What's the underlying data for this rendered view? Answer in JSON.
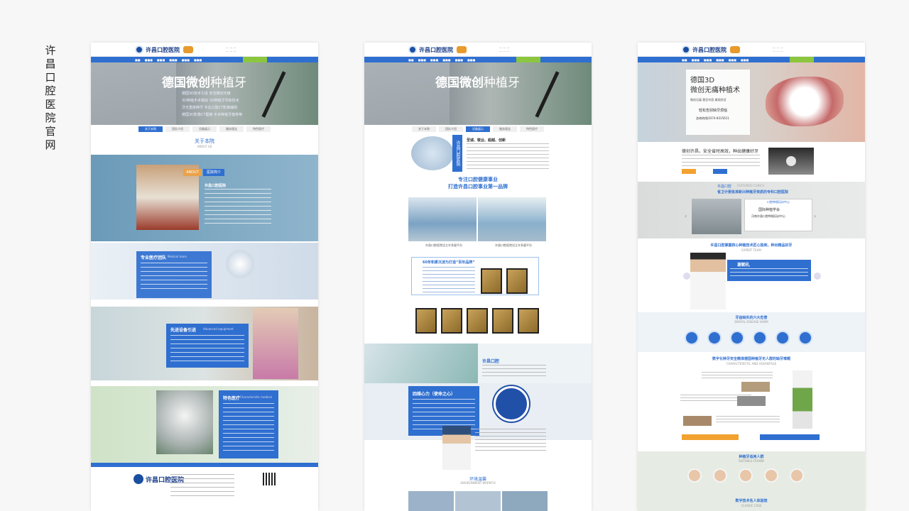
{
  "side_title": [
    "许",
    "昌",
    "口",
    "腔",
    "医",
    "院",
    "官",
    "网"
  ],
  "panel1": {
    "logo_text": "许昌口腔医院",
    "hero_title_bold": "德国微创",
    "hero_title_light": "种植牙",
    "hero_lines": [
      "德国3D技术引进 安全微创无痛",
      "3D种植手术模拟 3D种植牙导板技术",
      "牙无重度种牙 专业口腔CT影像辅助",
      "德国3D影像CT图像 手术种植牙植骨等"
    ],
    "tabs": [
      "关于本院",
      "团队介绍",
      "设备展示",
      "服务理念",
      "特色医疗"
    ],
    "about_title": "关于本院",
    "about_sub": "ABOUT US",
    "about_tag": "ABOUT",
    "about_badge": "医院简介",
    "about_heading": "许昌口腔医院",
    "team_heading": "专业医疗团队",
    "team_sub": "Medical team",
    "equip_heading": "先进设备引进",
    "equip_sub": "Advanced equipment",
    "feature_heading": "特色医疗",
    "feature_sub": "Characteristic medical",
    "footer_logo": "许昌口腔医院"
  },
  "panel2": {
    "logo_text": "许昌口腔医院",
    "hero_title_bold": "德国微创",
    "hero_title_light": "种植牙",
    "tabs": [
      "关于本院",
      "团队介绍",
      "设备展示",
      "服务理念",
      "特色医疗"
    ],
    "intro_vertical": "许昌口腔医院",
    "intro_heading": "至诚、敬业、超越、创新",
    "slogan1": "专注口腔健康事业",
    "slogan2": "打造许昌口腔事业第一品牌",
    "photo_cap1": "许昌口腔医院设立许多量平台",
    "photo_cap2": "许昌口腔医院设立许多量平台",
    "brand_title": "60年积累沉淀为打造“百年品牌”",
    "clinic_heading": "许昌口腔",
    "mission_heading": "四维心力（使命之心）",
    "env_title": "环境温馨",
    "env_sub": "ENVIRONMENT WARMTH"
  },
  "panel3": {
    "logo_text": "许昌口腔医院",
    "hero_title1": "德国3D",
    "hero_title2": "微创无痛种植术",
    "hero_tags": "微创无痛  稳定牢固  美观舒适",
    "hero_cta": "轻松告别缺牙烦恼",
    "hero_phone": "咨询热线|0374-8315611",
    "choose_title": "德创许昌，安全省时高效，种出健康好牙",
    "clinic_tag": "许昌口腔",
    "clinic_tag_en": "FEATURED CLINICS",
    "clinic_title": "省卫计委批准新兴种植牙资质的专科口腔医院",
    "center_label": "口腔种植培训中心",
    "center_plaque1": "国际种植学会",
    "center_plaque2": "河南许昌口腔种植培训中心",
    "expert_title": "许昌口腔掌握核心种植技术匠心独到，种出精品好牙",
    "expert_sub": "EXPERT TEAM",
    "expert_name": "谢朝礼",
    "harm_title": "牙齿缺失的六大危害",
    "harm_sub": "DENTAL DISEASE HARM",
    "adv_title": "数字化种牙安全精准德国种植牙无人群的缺牙难题",
    "adv_sub": "CHARACTERISTIC AND ADVANTAGE",
    "crowd_title": "种植牙适用人群",
    "crowd_sub": "SUITABLE CROWD",
    "case_title": "数字技术名人体验馆",
    "case_sub": "CLASSIC CASE"
  },
  "colors": {
    "brand_blue": "#2f6fd0",
    "accent_green": "#8cc63f",
    "accent_orange": "#f2a230"
  }
}
